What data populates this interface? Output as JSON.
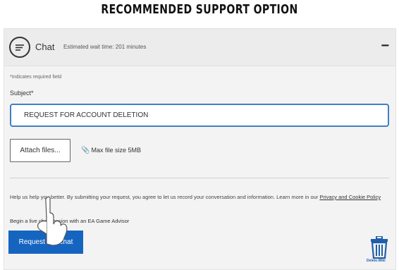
{
  "page_title": "RECOMMENDED SUPPORT OPTION",
  "chat": {
    "label": "Chat",
    "wait_text": "Estimated wait time: 201 minutes",
    "collapse_symbol": "−"
  },
  "form": {
    "required_note": "*Indicates required field",
    "subject_label": "Subject*",
    "subject_value": "REQUEST FOR ACCOUNT DELETION",
    "attach_label": "Attach files...",
    "max_file_text": "Max file size 5MB",
    "consent_text": "Help us help you better. By submitting your request, you agree to let us record your conversation and information. Learn more in our",
    "privacy_link": "Privacy and Cookie Policy",
    "begin_text": "Begin a live chat session with an EA Game Advisor",
    "live_chat_button": "Request live chat"
  },
  "watermark": "Delete.Wiki",
  "colors": {
    "accent": "#1565c0",
    "input_border": "#3f7fc6",
    "panel_bg": "#f3f3f3"
  },
  "icons": [
    "chat-bubble-icon",
    "paperclip-icon",
    "pointing-hand-icon",
    "trash-icon"
  ]
}
